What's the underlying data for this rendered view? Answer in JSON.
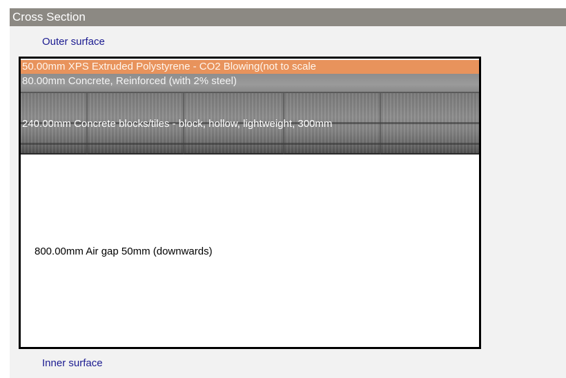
{
  "panel": {
    "title": "Cross Section"
  },
  "surfaces": {
    "outer": "Outer surface",
    "inner": "Inner surface"
  },
  "layers": [
    {
      "label": "50.00mm   XPS Extruded Polystyrene  - CO2 Blowing(not to scale",
      "color": "#e8935c"
    },
    {
      "label": "80.00mm   Concrete, Reinforced (with 2% steel)",
      "color": "#939393"
    },
    {
      "label": "240.00mm Concrete blocks/tiles - block, hollow, lightweight, 300mm",
      "color": "#7d7d7d"
    },
    {
      "label": "800.00mm Air gap 50mm (downwards)",
      "color": "#ffffff"
    }
  ]
}
